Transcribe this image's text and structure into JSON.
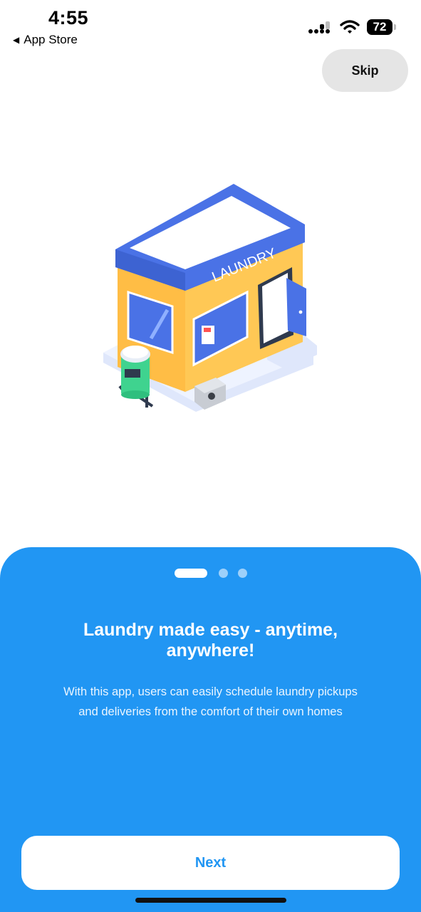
{
  "status_bar": {
    "time": "4:55",
    "back_label": "App Store",
    "battery": "72"
  },
  "header": {
    "skip_label": "Skip"
  },
  "illustration": {
    "sign_text": "LAUNDRY"
  },
  "onboarding": {
    "page_indicator": {
      "total": 3,
      "active_index": 0
    },
    "title": "Laundry made easy - anytime, anywhere!",
    "description": "With this app, users can easily schedule laundry pickups and deliveries from the comfort of their own homes",
    "next_label": "Next"
  },
  "colors": {
    "primary": "#2196f3",
    "building_wall": "#ffbd45",
    "roof": "#4a72e6",
    "trash_can": "#3fd38f"
  },
  "icons": [
    "back-arrow-icon",
    "cellular-signal-icon",
    "wifi-icon",
    "battery-icon",
    "laundry-shop-illustration"
  ]
}
